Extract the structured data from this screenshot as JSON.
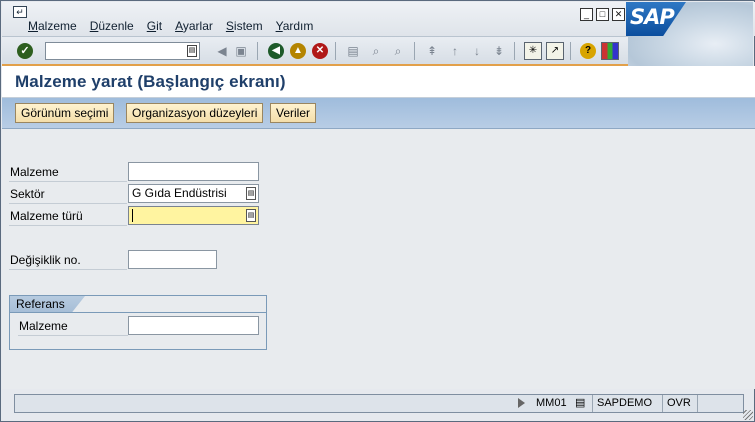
{
  "menu": {
    "items": [
      "Malzeme",
      "Düzenle",
      "Git",
      "Ayarlar",
      "Sistem",
      "Yardım"
    ]
  },
  "window_controls": {
    "minimize": "_",
    "maximize": "□",
    "close": "✕"
  },
  "logo": {
    "text": "SAP"
  },
  "toolbar": {
    "command_field_value": "",
    "icons": [
      "enter-icon",
      "back-arrow-icon",
      "save-icon",
      "back-icon",
      "exit-icon",
      "cancel-icon",
      "print-icon",
      "find-icon",
      "find-next-icon",
      "first-page-icon",
      "previous-page-icon",
      "next-page-icon",
      "last-page-icon",
      "create-session-icon",
      "shortcut-icon",
      "help-icon",
      "layout-menu-icon"
    ]
  },
  "title": "Malzeme yarat (Başlangıç ekranı)",
  "app_toolbar": {
    "buttons": [
      "Görünüm seçimi",
      "Organizasyon düzeyleri",
      "Veriler"
    ]
  },
  "form": {
    "material_label": "Malzeme",
    "material_value": "",
    "sector_label": "Sektör",
    "sector_value": "G Gıda Endüstrisi",
    "material_type_label": "Malzeme türü",
    "material_type_value": "",
    "change_no_label": "Değişiklik no.",
    "change_no_value": ""
  },
  "reference_group": {
    "title": "Referans",
    "material_label": "Malzeme",
    "material_value": ""
  },
  "statusbar": {
    "transaction": "MM01",
    "system": "SAPDEMO",
    "mode": "OVR"
  },
  "colors": {
    "title_text": "#1f3f6a",
    "app_toolbar_bg": "#9fbcdc",
    "required_field": "#fff4a0",
    "button_bg": "#f4deaa",
    "accent_line": "#e2a04a"
  }
}
